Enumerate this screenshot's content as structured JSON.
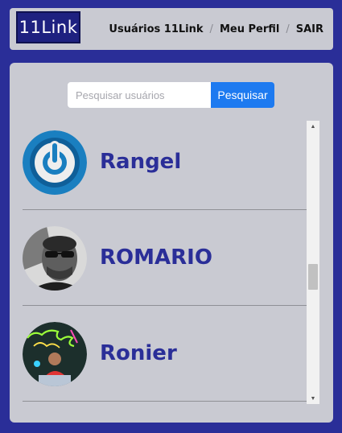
{
  "navbar": {
    "logo_text": "11Link",
    "links": [
      {
        "label": "Usuários 11Link"
      },
      {
        "label": "Meu Perfil"
      },
      {
        "label": "SAIR"
      }
    ],
    "separator": "/"
  },
  "search": {
    "placeholder": "Pesquisar usuários",
    "value": "",
    "button_label": "Pesquisar"
  },
  "users": [
    {
      "name": "Rangel",
      "avatar": "power-logo-avatar"
    },
    {
      "name": "ROMARIO",
      "avatar": "photo-man-sunglasses-avatar"
    },
    {
      "name": "Ronier",
      "avatar": "photo-neon-soul-caller-avatar"
    }
  ],
  "scroll": {
    "position_fraction": 0.5
  },
  "colors": {
    "background": "#2a2e98",
    "panel": "#c9cad2",
    "accent_button": "#1d7af0",
    "name_text": "#2a2e98"
  }
}
